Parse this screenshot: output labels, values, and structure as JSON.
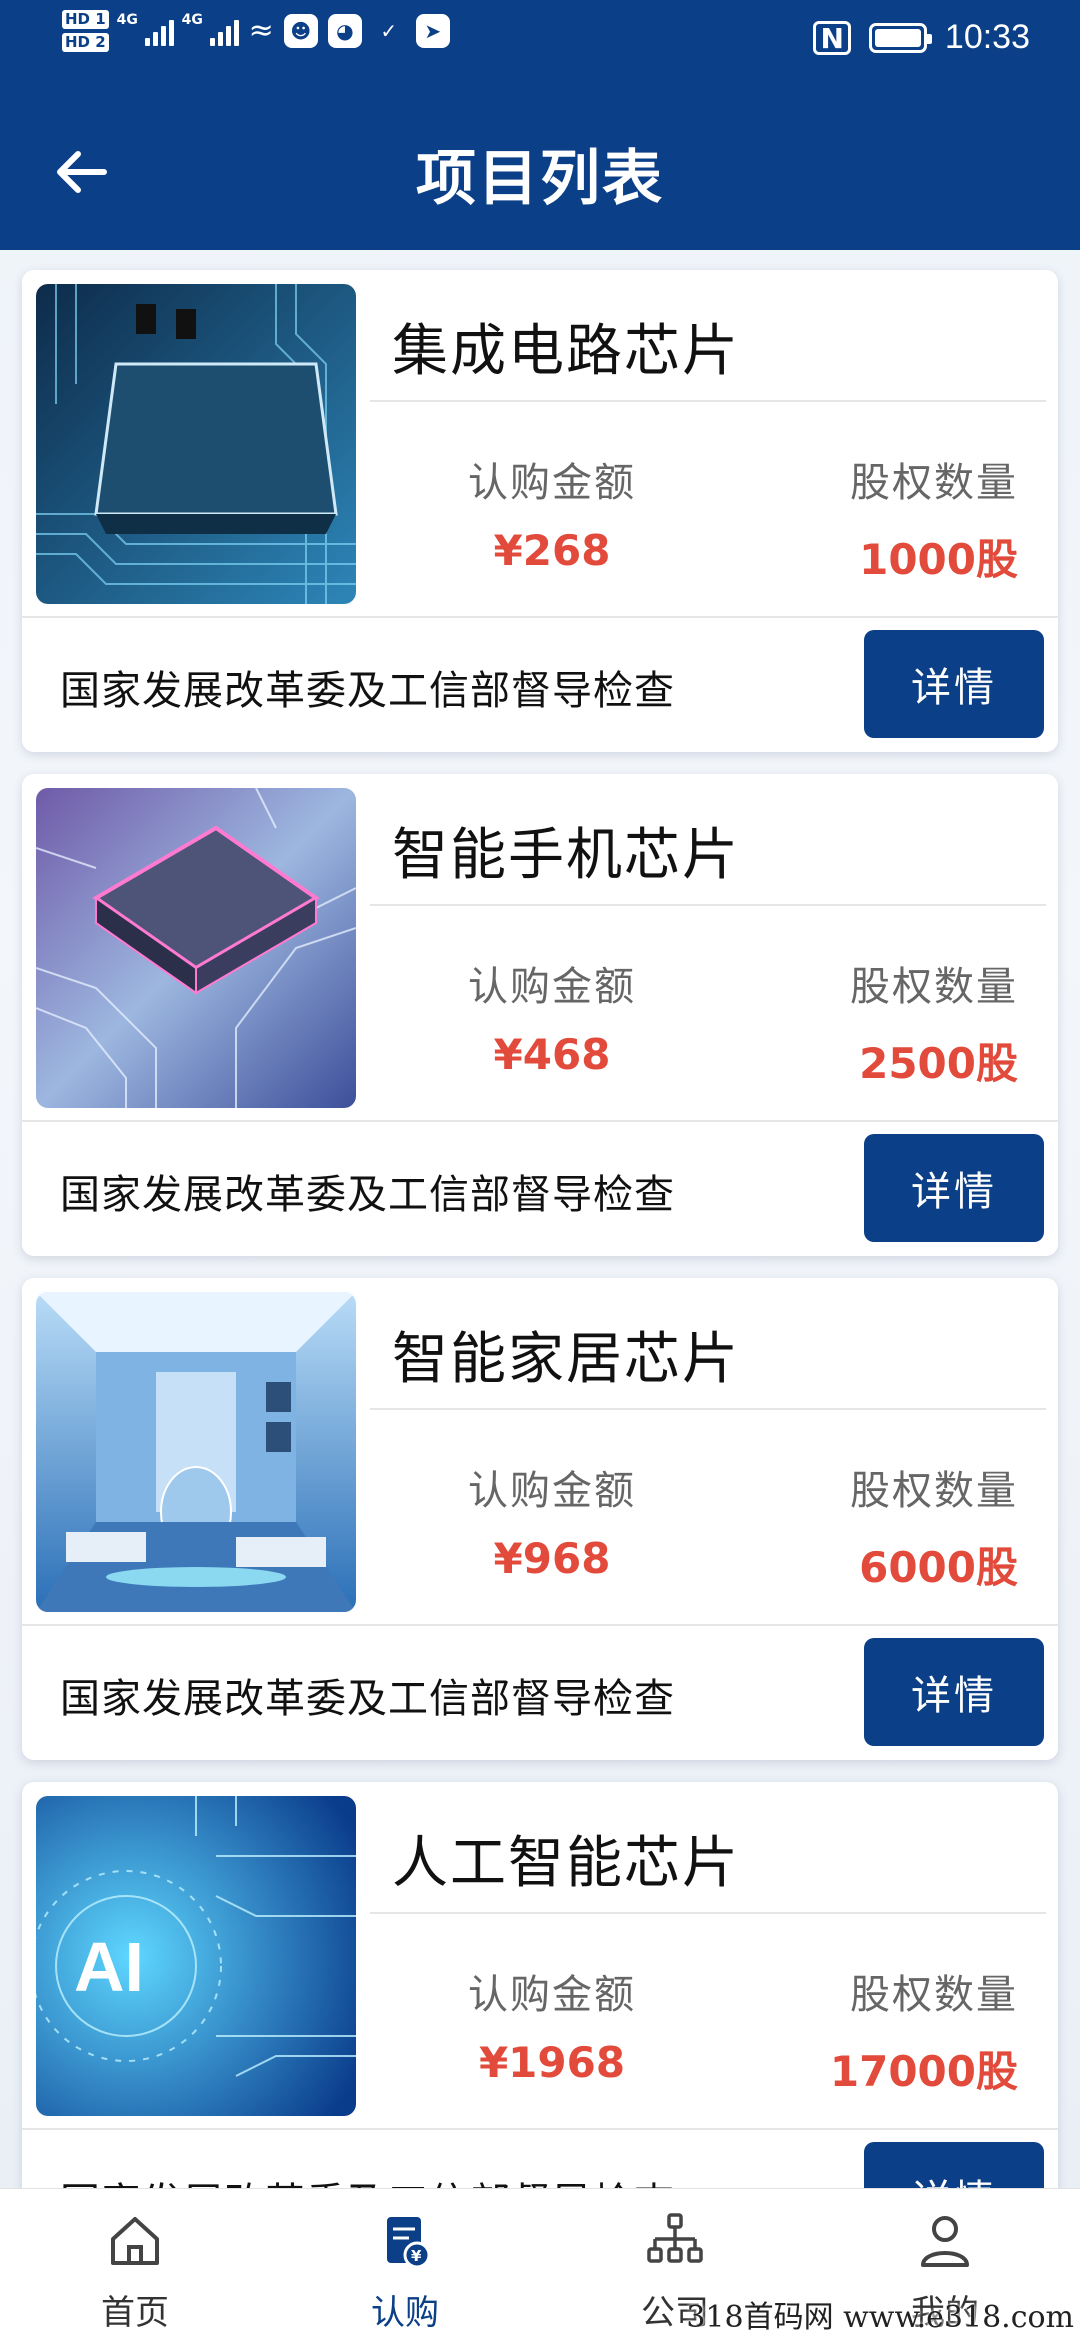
{
  "status_bar": {
    "hd1": "HD 1",
    "hd2": "HD 2",
    "net1": "4G",
    "net2": "4G",
    "nfc": "N",
    "time": "10:33"
  },
  "header": {
    "title": "项目列表",
    "back_icon": "arrow-left-icon"
  },
  "projects": [
    {
      "title": "集成电路芯片",
      "amount_label": "认购金额",
      "amount": "¥268",
      "shares_label": "股权数量",
      "shares": "1000股",
      "note": "国家发展改革委及工信部督导检查",
      "button": "详情",
      "image": "circuit-chip-image"
    },
    {
      "title": "智能手机芯片",
      "amount_label": "认购金额",
      "amount": "¥468",
      "shares_label": "股权数量",
      "shares": "2500股",
      "note": "国家发展改革委及工信部督导检查",
      "button": "详情",
      "image": "glowing-chip-image"
    },
    {
      "title": "智能家居芯片",
      "amount_label": "认购金额",
      "amount": "¥968",
      "shares_label": "股权数量",
      "shares": "6000股",
      "note": "国家发展改革委及工信部督导检查",
      "button": "详情",
      "image": "smart-home-image"
    },
    {
      "title": "人工智能芯片",
      "amount_label": "认购金额",
      "amount": "¥1968",
      "shares_label": "股权数量",
      "shares": "17000股",
      "note": "国家发展改革委及工信部督导检查",
      "button": "详情",
      "image": "ai-chip-image"
    }
  ],
  "tabbar": {
    "tabs": [
      {
        "label": "首页",
        "icon": "home-icon"
      },
      {
        "label": "认购",
        "icon": "subscribe-icon"
      },
      {
        "label": "公司",
        "icon": "org-chart-icon"
      },
      {
        "label": "我的",
        "icon": "user-icon"
      }
    ],
    "active": "认购"
  },
  "watermark": "318首码网 www.e318.com",
  "colors": {
    "primary": "#0b3f87",
    "price": "#e24b3c",
    "card_bg": "#ffffff"
  }
}
